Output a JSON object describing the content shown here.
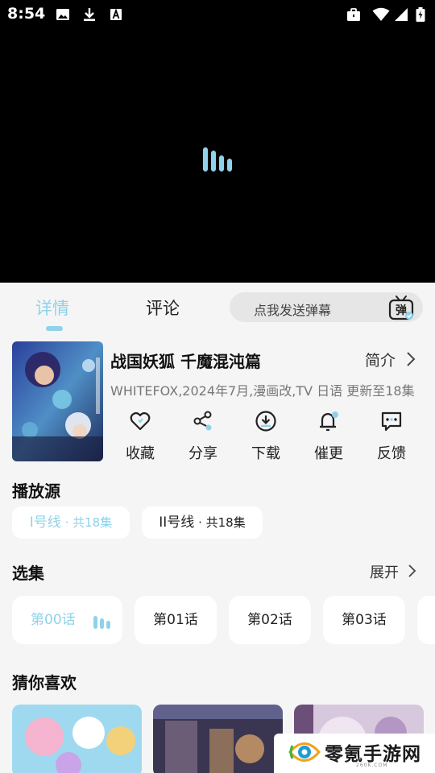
{
  "status_bar": {
    "time": "8:54"
  },
  "tabs": {
    "details": "详情",
    "comments": "评论"
  },
  "danmaku": {
    "placeholder": "点我发送弹幕",
    "icon_label": "弹"
  },
  "anime": {
    "title": "战国妖狐 千魔混沌篇",
    "intro": "简介",
    "meta": "WHITEFOX,2024年7月,漫画改,TV 日语 更新至18集"
  },
  "actions": [
    {
      "label": "收藏",
      "icon": "heart-icon"
    },
    {
      "label": "分享",
      "icon": "share-icon"
    },
    {
      "label": "下载",
      "icon": "download-icon"
    },
    {
      "label": "催更",
      "icon": "bell-icon"
    },
    {
      "label": "反馈",
      "icon": "feedback-icon"
    }
  ],
  "sources": {
    "heading": "播放源",
    "items": [
      {
        "name": "I号线",
        "sep": " · ",
        "count": "共18集"
      },
      {
        "name": "II号线",
        "sep": " · ",
        "count": "共18集"
      }
    ]
  },
  "episodes": {
    "heading": "选集",
    "expand": "展开",
    "items": [
      "第00话",
      "第01话",
      "第02话",
      "第03话"
    ]
  },
  "recommend": {
    "heading": "猜你喜欢"
  },
  "watermark": {
    "name": "零氪手游网",
    "domain": "260K.COM"
  },
  "colors": {
    "accent": "#8fd2ea",
    "background": "#f5f5f5",
    "video": "#000000"
  }
}
